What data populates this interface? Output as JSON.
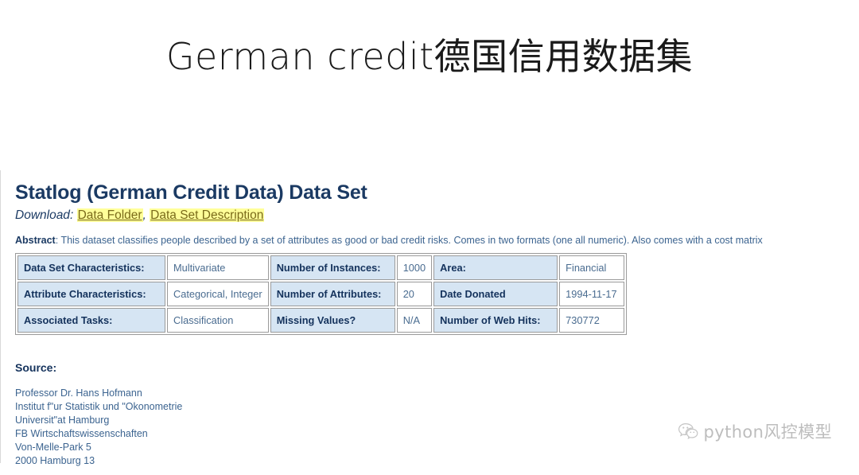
{
  "slide": {
    "title": "German credit德国信用数据集"
  },
  "dataset": {
    "heading": "Statlog (German Credit Data) Data Set",
    "download_label": "Download",
    "download_colon": ":",
    "links": [
      {
        "label": "Data Folder"
      },
      {
        "label": "Data Set Description"
      }
    ],
    "link_separator": ",",
    "abstract_label": "Abstract",
    "abstract_text": ": This dataset classifies people described by a set of attributes as good or bad credit risks. Comes in two formats (one all numeric). Also comes with a cost matrix"
  },
  "attributes_table": {
    "rows": [
      {
        "label1": "Data Set Characteristics:",
        "value1": "Multivariate",
        "label2": "Number of Instances:",
        "value2": "1000",
        "label3": "Area:",
        "value3": "Financial"
      },
      {
        "label1": "Attribute Characteristics:",
        "value1": "Categorical, Integer",
        "label2": "Number of Attributes:",
        "value2": "20",
        "label3": "Date Donated",
        "value3": "1994-11-17"
      },
      {
        "label1": "Associated Tasks:",
        "value1": "Classification",
        "label2": "Missing Values?",
        "value2": "N/A",
        "label3": "Number of Web Hits:",
        "value3": "730772"
      }
    ]
  },
  "source": {
    "title": "Source:",
    "lines": [
      "Professor Dr. Hans Hofmann",
      "Institut f\"ur Statistik und \"Okonometrie",
      "Universit\"at Hamburg",
      "FB Wirtschaftswissenschaften",
      "Von-Melle-Park 5",
      "2000 Hamburg 13"
    ]
  },
  "watermark": {
    "icon": "wechat-icon",
    "text": "python风控模型"
  },
  "colors": {
    "heading_navy": "#1b3a63",
    "body_blue": "#3c6490",
    "cell_label_bg": "#d6e5f3",
    "highlight_yellow": "#ffff99",
    "link_olive": "#7a6a1a",
    "table_border": "#9a9a9a"
  }
}
